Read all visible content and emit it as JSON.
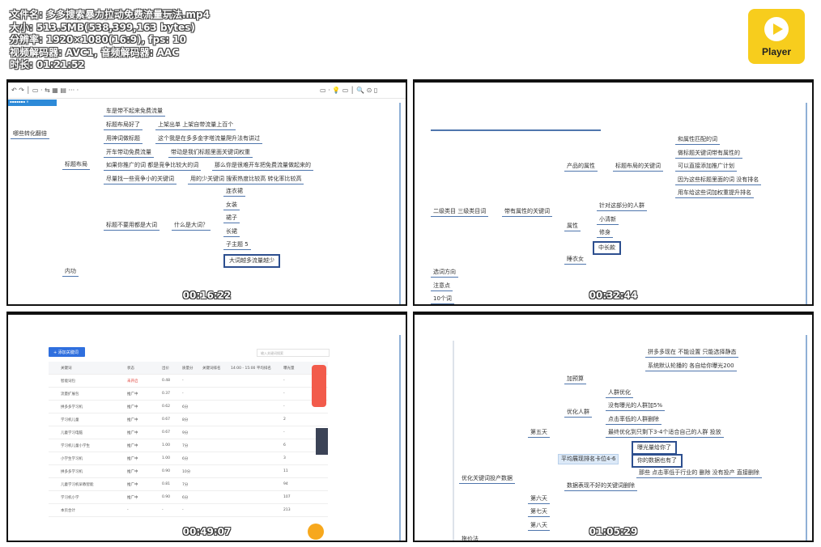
{
  "file_info": {
    "filename": "文件名: 多多搜索暴力拉动免费流量玩法.mp4",
    "size": "大小: 513.5MB(538,399,163 bytes)",
    "resolution": "分辨率: 1920×1080(16:9), fps: 10",
    "codecs": "视频解码器: AVC1, 音频解码器: AAC",
    "duration": "时长: 01:21:52"
  },
  "logo": {
    "label": "Player",
    "color": "#f7cd1d",
    "icon": "play-icon"
  },
  "panels": [
    {
      "timestamp": "00:16:22",
      "nodes": [
        "哪些转化翻倍",
        "标题布局",
        "车是带不起来免费流量",
        "标题布局好了",
        "上架出单  上架自带流量上百个",
        "用神词做标题",
        "这个我是在多多金字塔流量爬升法有讲过",
        "开车带动免费流量",
        "带动是我们标题里面关键词权重",
        "如果你推广的词 都是竞争比较大的词",
        "那么你是很难开车把免费流量做起来的",
        "尽量找一些竞争小的关键词",
        "用的少关键词  搜索热度比较高  转化率比较高",
        "标题不要用都是大词",
        "什么是大词？",
        "连衣裙",
        "女装",
        "裙子",
        "长裙",
        "子主题 5",
        "大词越多流量越少",
        "内功"
      ]
    },
    {
      "timestamp": "00:32:44",
      "nodes": [
        "二级类目  三级类目词",
        "带有属性的关键词",
        "产品的属性",
        "标题布局的关键词",
        "和属性匹配的词",
        "做标题关键词带有属性的",
        "可以直接添加推广计划",
        "因为这些标题里面的词 没有排名",
        "用车给这些词加权重提升排名",
        "属性",
        "针对这部分的人群",
        "小清新",
        "修身",
        "中长款",
        "睡衣女",
        "选词方向",
        "注意点",
        "10个词"
      ]
    },
    {
      "timestamp": "00:49:07",
      "add_button": "+ 添加关键词",
      "search_placeholder": "输入关键词搜索",
      "headers": [
        "关键词",
        "状态",
        "出价",
        "质量分",
        "关键词排名",
        "14:00 - 15:00 平均排名",
        "曝光量"
      ],
      "rows": [
        [
          "智能词包",
          "未开启",
          "0.48",
          "-",
          "-"
        ],
        [
          "流量扩展包",
          "推广中",
          "0.37",
          "-",
          "-"
        ],
        [
          "拼多多学习机",
          "推广中",
          "0.62",
          "6分",
          "-"
        ],
        [
          "学习机儿童",
          "推广中",
          "0.67",
          "8分",
          "2"
        ],
        [
          "儿童学习电脑",
          "推广中",
          "0.67",
          "9分",
          "-"
        ],
        [
          "学习机儿童小学生",
          "推广中",
          "1.00",
          "7分",
          "6"
        ],
        [
          "小学生学习机",
          "推广中",
          "1.00",
          "6分",
          "3"
        ],
        [
          "拼多多学习机",
          "推广中",
          "0.90",
          "10分",
          "11"
        ],
        [
          "儿童学习机早教智能",
          "推广中",
          "0.81",
          "7分",
          "94"
        ],
        [
          "学习机小学",
          "推广中",
          "0.90",
          "6分",
          "107"
        ],
        [
          "本页合计",
          "-",
          "-",
          "-",
          "213"
        ]
      ],
      "accent": "#2f6fde"
    },
    {
      "timestamp": "01:05:29",
      "nodes": [
        "拼多多现在  不能设置 只能选择静态",
        "系统默认轮播的  各自给你曝光200",
        "加预算",
        "优化人群",
        "人群优化",
        "没有曝光的人群加5%",
        "点击率低的人群删除",
        "最终优化到只剩下3-4个适合自己的人群  投放",
        "第五天",
        "平均展现排名卡位4-6",
        "曝光量给你了",
        "你的数据也有了",
        "那些 点击率低于行业的  删除   没有投产  直接删除",
        "数据表现不好的关键词删除",
        "优化关键词投产数据",
        "第六天",
        "第七天",
        "第八天",
        "拖价法"
      ]
    }
  ]
}
